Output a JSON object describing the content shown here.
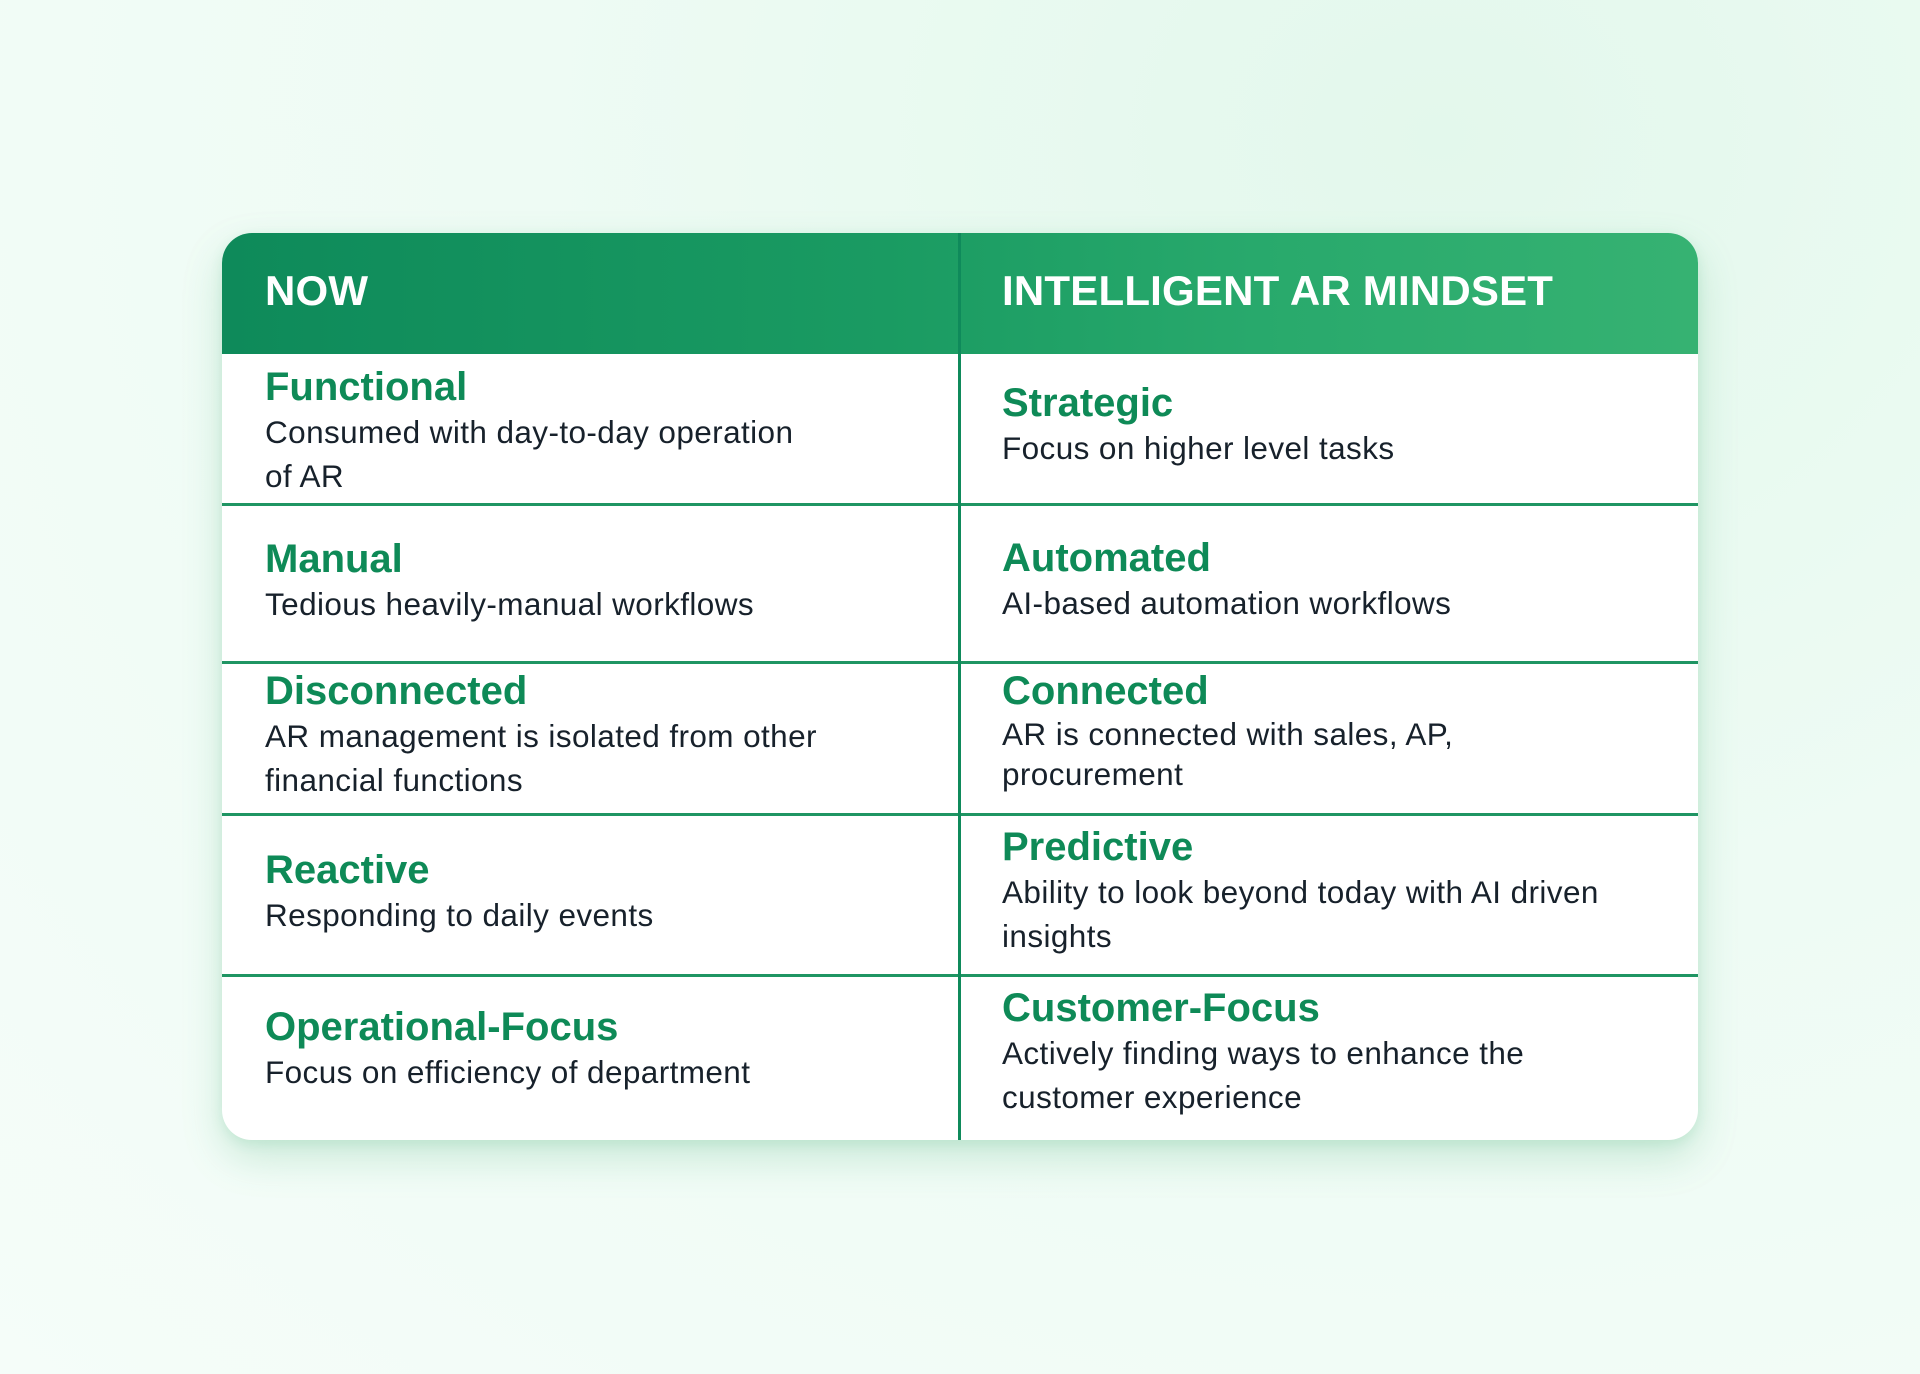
{
  "table": {
    "headers": {
      "now": "NOW",
      "future": "INTELLIGENT AR MINDSET"
    },
    "rows": [
      {
        "now": {
          "title": "Functional",
          "desc": "Consumed with day-to-day operation of AR"
        },
        "future": {
          "title": "Strategic",
          "desc": "Focus on higher level tasks"
        }
      },
      {
        "now": {
          "title": "Manual",
          "desc": "Tedious heavily-manual workflows"
        },
        "future": {
          "title": "Automated",
          "desc": "AI-based automation workflows"
        }
      },
      {
        "now": {
          "title": "Disconnected",
          "desc": "AR management is isolated from other financial functions"
        },
        "future": {
          "title": "Connected",
          "desc": "AR is connected with sales, AP, procurement"
        }
      },
      {
        "now": {
          "title": "Reactive",
          "desc": "Responding to daily events"
        },
        "future": {
          "title": "Predictive",
          "desc": "Ability to look beyond today with AI driven insights"
        }
      },
      {
        "now": {
          "title": "Operational-Focus",
          "desc": "Focus on efficiency of department"
        },
        "future": {
          "title": "Customer-Focus",
          "desc": "Actively finding ways to enhance the customer experience"
        }
      }
    ]
  },
  "colors": {
    "header_start": "#0e8a5a",
    "header_end": "#36b272",
    "title_green": "#0e8a57",
    "divider": "#1f9563",
    "body_text": "#17212b"
  }
}
